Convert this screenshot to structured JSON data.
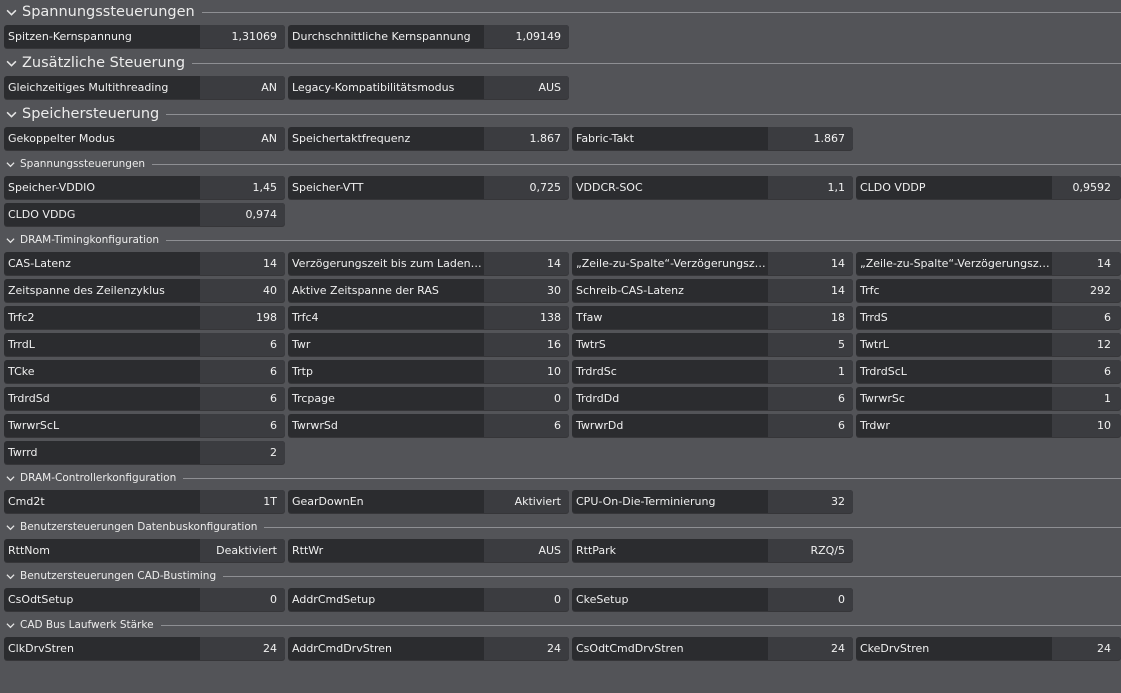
{
  "sections": [
    {
      "title": "Spannungssteuerungen",
      "size": "big",
      "rows": [
        [
          {
            "label": "Spitzen-Kernspannung",
            "value": "1,31069"
          },
          {
            "label": "Durchschnittliche Kernspannung",
            "value": "1,09149"
          }
        ]
      ]
    },
    {
      "title": "Zusätzliche Steuerung",
      "size": "big",
      "rows": [
        [
          {
            "label": "Gleichzeitiges Multithreading",
            "value": "AN"
          },
          {
            "label": "Legacy-Kompatibilitätsmodus",
            "value": "AUS"
          }
        ]
      ]
    },
    {
      "title": "Speichersteuerung",
      "size": "big",
      "rows": [
        [
          {
            "label": "Gekoppelter Modus",
            "value": "AN"
          },
          {
            "label": "Speichertaktfrequenz",
            "value": "1.867"
          },
          {
            "label": "Fabric-Takt",
            "value": "1.867"
          }
        ]
      ]
    },
    {
      "title": "Spannungssteuerungen",
      "size": "small",
      "rows": [
        [
          {
            "label": "Speicher-VDDIO",
            "value": "1,45"
          },
          {
            "label": "Speicher-VTT",
            "value": "0,725"
          },
          {
            "label": "VDDCR-SOC",
            "value": "1,1"
          },
          {
            "label": "CLDO VDDP",
            "value": "0,9592"
          }
        ],
        [
          {
            "label": "CLDO VDDG",
            "value": "0,974"
          }
        ]
      ]
    },
    {
      "title": "DRAM-Timingkonfiguration",
      "size": "small",
      "rows": [
        [
          {
            "label": "CAS-Latenz",
            "value": "14"
          },
          {
            "label": "Verzögerungszeit bis zum Laden der Reihe",
            "value": "14"
          },
          {
            "label": "„Zeile-zu-Spalte“-Verzögerungszeit für Lesen",
            "value": "14"
          },
          {
            "label": "„Zeile-zu-Spalte“-Verzögerungszeit für Schreiben",
            "value": "14"
          }
        ],
        [
          {
            "label": "Zeitspanne des Zeilenzyklus",
            "value": "40"
          },
          {
            "label": "Aktive Zeitspanne der RAS",
            "value": "30"
          },
          {
            "label": "Schreib-CAS-Latenz",
            "value": "14"
          },
          {
            "label": "Trfc",
            "value": "292"
          }
        ],
        [
          {
            "label": "Trfc2",
            "value": "198"
          },
          {
            "label": "Trfc4",
            "value": "138"
          },
          {
            "label": "Tfaw",
            "value": "18"
          },
          {
            "label": "TrrdS",
            "value": "6"
          }
        ],
        [
          {
            "label": "TrrdL",
            "value": "6"
          },
          {
            "label": "Twr",
            "value": "16"
          },
          {
            "label": "TwtrS",
            "value": "5"
          },
          {
            "label": "TwtrL",
            "value": "12"
          }
        ],
        [
          {
            "label": "TCke",
            "value": "6"
          },
          {
            "label": "Trtp",
            "value": "10"
          },
          {
            "label": "TrdrdSc",
            "value": "1"
          },
          {
            "label": "TrdrdScL",
            "value": "6"
          }
        ],
        [
          {
            "label": "TrdrdSd",
            "value": "6"
          },
          {
            "label": "Trcpage",
            "value": "0"
          },
          {
            "label": "TrdrdDd",
            "value": "6"
          },
          {
            "label": "TwrwrSc",
            "value": "1"
          }
        ],
        [
          {
            "label": "TwrwrScL",
            "value": "6"
          },
          {
            "label": "TwrwrSd",
            "value": "6"
          },
          {
            "label": "TwrwrDd",
            "value": "6"
          },
          {
            "label": "Trdwr",
            "value": "10"
          }
        ],
        [
          {
            "label": "Twrrd",
            "value": "2"
          }
        ]
      ]
    },
    {
      "title": "DRAM-Controllerkonfiguration",
      "size": "small",
      "rows": [
        [
          {
            "label": "Cmd2t",
            "value": "1T"
          },
          {
            "label": "GearDownEn",
            "value": "Aktiviert"
          },
          {
            "label": "CPU-On-Die-Terminierung",
            "value": "32"
          }
        ]
      ]
    },
    {
      "title": "Benutzersteuerungen Datenbuskonfiguration",
      "size": "small",
      "rows": [
        [
          {
            "label": "RttNom",
            "value": "Deaktiviert"
          },
          {
            "label": "RttWr",
            "value": "AUS"
          },
          {
            "label": "RttPark",
            "value": "RZQ/5"
          }
        ]
      ]
    },
    {
      "title": "Benutzersteuerungen CAD-Bustiming",
      "size": "small",
      "rows": [
        [
          {
            "label": "CsOdtSetup",
            "value": "0"
          },
          {
            "label": "AddrCmdSetup",
            "value": "0"
          },
          {
            "label": "CkeSetup",
            "value": "0"
          }
        ]
      ]
    },
    {
      "title": "CAD Bus Laufwerk Stärke",
      "size": "small",
      "rows": [
        [
          {
            "label": "ClkDrvStren",
            "value": "24"
          },
          {
            "label": "AddrCmdDrvStren",
            "value": "24"
          },
          {
            "label": "CsOdtCmdDrvStren",
            "value": "24"
          },
          {
            "label": "CkeDrvStren",
            "value": "24"
          }
        ]
      ]
    }
  ],
  "colors": {
    "background": "#535458",
    "cell_label_bg": "#2b2c2f",
    "cell_value_bg": "#3b3c40",
    "divider": "#8e8f93"
  },
  "icons": {
    "section_toggle": "chevron-down-icon"
  }
}
